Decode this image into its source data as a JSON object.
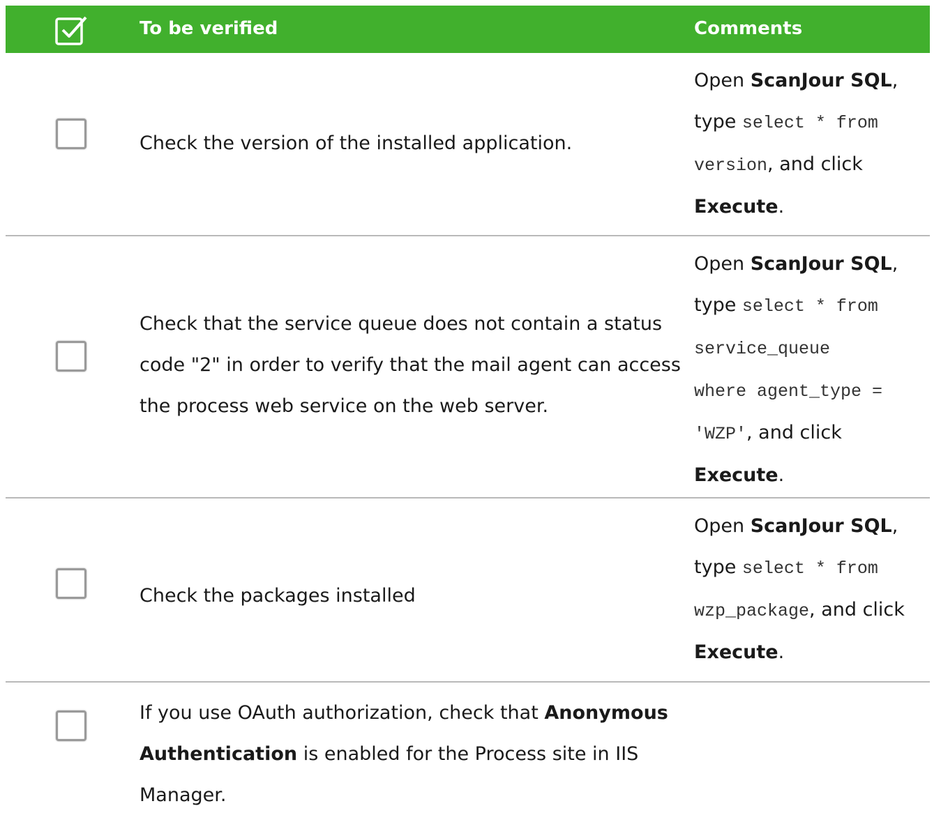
{
  "header": {
    "icon": "checkbox-checked-icon",
    "verify_title": "To be verified",
    "comments_title": "Comments",
    "color": "#41b02d"
  },
  "rows": [
    {
      "checked": false,
      "verify": "Check the version of the installed application.",
      "comment": {
        "open": "Open ",
        "app": "ScanJour SQL",
        "comma": ",",
        "type": "type ",
        "sql_1": "select * from",
        "sql_2": "version",
        "and_click": ", and click",
        "execute": "Execute",
        "period": "."
      }
    },
    {
      "checked": false,
      "verify": "Check that the service queue does not contain a status code \"2\" in order to verify that the mail agent can access the process web service on the web server.",
      "comment": {
        "open": "Open ",
        "app": "ScanJour SQL",
        "comma": ",",
        "type": "type ",
        "sql_1": "select * from",
        "sql_2": "service_queue",
        "sql_3": "where agent_type =",
        "sql_4": "'WZP'",
        "and_click": ", and click",
        "execute": "Execute",
        "period": "."
      }
    },
    {
      "checked": false,
      "verify": "Check the packages installed",
      "comment": {
        "open": "Open ",
        "app": "ScanJour SQL",
        "comma": ",",
        "type": "type ",
        "sql_1": "select * from",
        "sql_2": "wzp_package",
        "and_click": ", and click",
        "execute": "Execute",
        "period": "."
      }
    },
    {
      "checked": false,
      "verify_pre": "If you use OAuth authorization, check that ",
      "verify_bold": "Anonymous Authentication",
      "verify_post": " is enabled for the Process site in IIS Manager."
    }
  ]
}
